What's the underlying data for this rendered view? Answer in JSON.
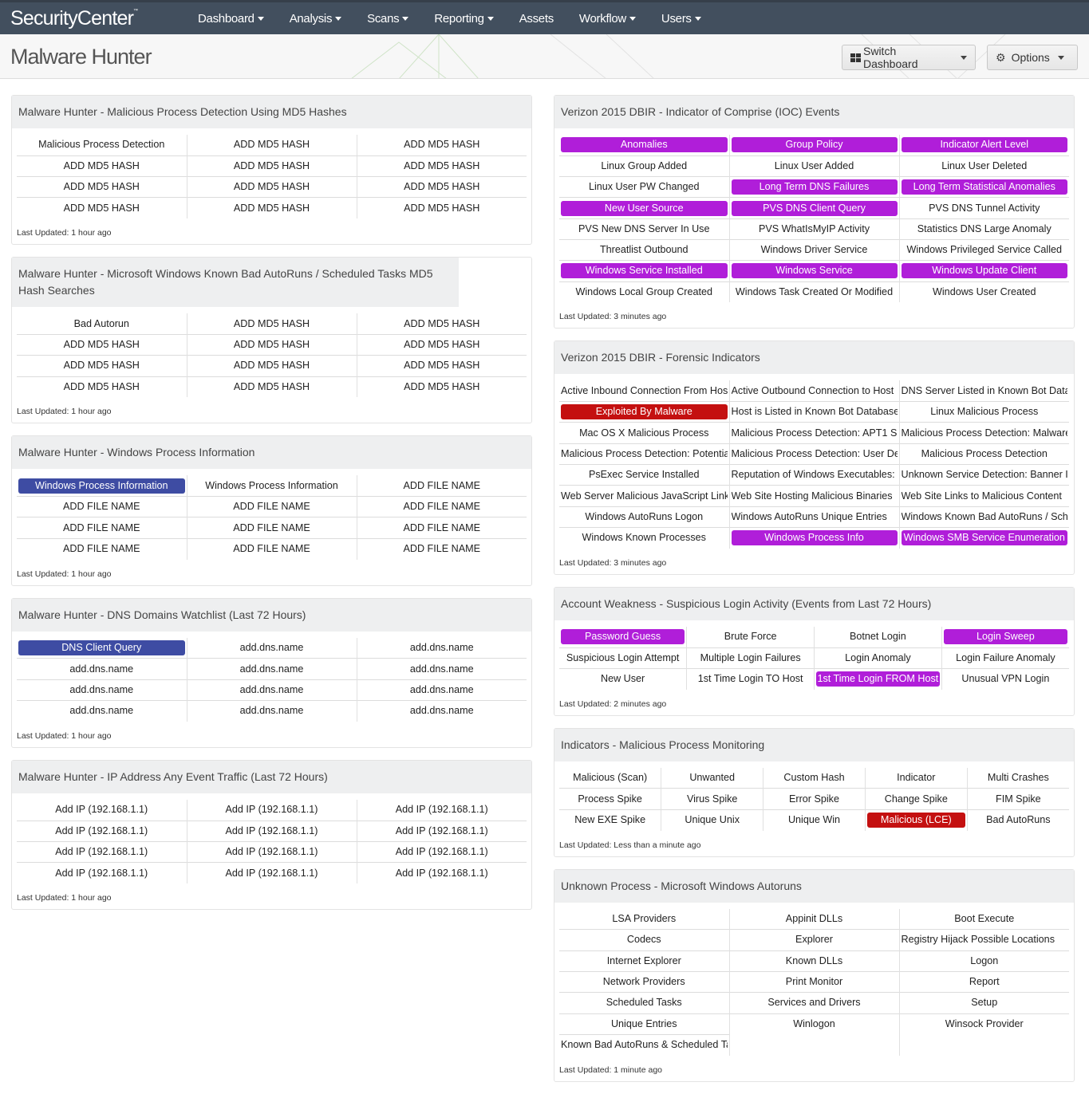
{
  "app": {
    "brand": "SecurityCenter",
    "nav": [
      "Dashboard",
      "Analysis",
      "Scans",
      "Reporting",
      "Assets",
      "Workflow",
      "Users"
    ],
    "nav_has_caret": [
      true,
      true,
      true,
      true,
      false,
      true,
      true
    ]
  },
  "header": {
    "title": "Malware Hunter",
    "switch_dashboard": "Switch Dashboard",
    "options": "Options"
  },
  "colors": {
    "nav_bg": "#424f5e",
    "purple": "#b01ed9",
    "red": "#c41010",
    "blue": "#3e4ca3"
  },
  "left_panels": [
    {
      "title": "Malware Hunter - Malicious Process Detection Using MD5 Hashes",
      "updated": "Last Updated: 1 hour ago",
      "cols": 3,
      "cells": [
        {
          "t": "Malicious Process Detection",
          "s": null
        },
        {
          "t": "ADD MD5 HASH",
          "s": null
        },
        {
          "t": "ADD MD5 HASH",
          "s": null
        },
        {
          "t": "ADD MD5 HASH",
          "s": null
        },
        {
          "t": "ADD MD5 HASH",
          "s": null
        },
        {
          "t": "ADD MD5 HASH",
          "s": null
        },
        {
          "t": "ADD MD5 HASH",
          "s": null
        },
        {
          "t": "ADD MD5 HASH",
          "s": null
        },
        {
          "t": "ADD MD5 HASH",
          "s": null
        },
        {
          "t": "ADD MD5 HASH",
          "s": null
        },
        {
          "t": "ADD MD5 HASH",
          "s": null
        },
        {
          "t": "ADD MD5 HASH",
          "s": null
        }
      ]
    },
    {
      "title": "Malware Hunter - Microsoft Windows Known Bad AutoRuns / Scheduled Tasks MD5 Hash Searches",
      "updated": "Last Updated: 1 hour ago",
      "cols": 3,
      "cells": [
        {
          "t": "Bad Autorun",
          "s": null
        },
        {
          "t": "ADD MD5 HASH",
          "s": null
        },
        {
          "t": "ADD MD5 HASH",
          "s": null
        },
        {
          "t": "ADD MD5 HASH",
          "s": null
        },
        {
          "t": "ADD MD5 HASH",
          "s": null
        },
        {
          "t": "ADD MD5 HASH",
          "s": null
        },
        {
          "t": "ADD MD5 HASH",
          "s": null
        },
        {
          "t": "ADD MD5 HASH",
          "s": null
        },
        {
          "t": "ADD MD5 HASH",
          "s": null
        },
        {
          "t": "ADD MD5 HASH",
          "s": null
        },
        {
          "t": "ADD MD5 HASH",
          "s": null
        },
        {
          "t": "ADD MD5 HASH",
          "s": null
        }
      ]
    },
    {
      "title": "Malware Hunter - Windows Process Information",
      "updated": "Last Updated: 1 hour ago",
      "cols": 3,
      "cells": [
        {
          "t": "Windows Process Information",
          "s": "blue"
        },
        {
          "t": "Windows Process Information",
          "s": null
        },
        {
          "t": "ADD FILE NAME",
          "s": null
        },
        {
          "t": "ADD FILE NAME",
          "s": null
        },
        {
          "t": "ADD FILE NAME",
          "s": null
        },
        {
          "t": "ADD FILE NAME",
          "s": null
        },
        {
          "t": "ADD FILE NAME",
          "s": null
        },
        {
          "t": "ADD FILE NAME",
          "s": null
        },
        {
          "t": "ADD FILE NAME",
          "s": null
        },
        {
          "t": "ADD FILE NAME",
          "s": null
        },
        {
          "t": "ADD FILE NAME",
          "s": null
        },
        {
          "t": "ADD FILE NAME",
          "s": null
        }
      ]
    },
    {
      "title": "Malware Hunter - DNS Domains Watchlist (Last 72 Hours)",
      "updated": "Last Updated: 1 hour ago",
      "cols": 3,
      "cells": [
        {
          "t": "DNS Client Query",
          "s": "blue"
        },
        {
          "t": "add.dns.name",
          "s": null
        },
        {
          "t": "add.dns.name",
          "s": null
        },
        {
          "t": "add.dns.name",
          "s": null
        },
        {
          "t": "add.dns.name",
          "s": null
        },
        {
          "t": "add.dns.name",
          "s": null
        },
        {
          "t": "add.dns.name",
          "s": null
        },
        {
          "t": "add.dns.name",
          "s": null
        },
        {
          "t": "add.dns.name",
          "s": null
        },
        {
          "t": "add.dns.name",
          "s": null
        },
        {
          "t": "add.dns.name",
          "s": null
        },
        {
          "t": "add.dns.name",
          "s": null
        }
      ]
    },
    {
      "title": "Malware Hunter - IP Address Any Event Traffic (Last 72 Hours)",
      "updated": "Last Updated: 1 hour ago",
      "cols": 3,
      "cells": [
        {
          "t": "Add IP (192.168.1.1)",
          "s": null
        },
        {
          "t": "Add IP (192.168.1.1)",
          "s": null
        },
        {
          "t": "Add IP (192.168.1.1)",
          "s": null
        },
        {
          "t": "Add IP (192.168.1.1)",
          "s": null
        },
        {
          "t": "Add IP (192.168.1.1)",
          "s": null
        },
        {
          "t": "Add IP (192.168.1.1)",
          "s": null
        },
        {
          "t": "Add IP (192.168.1.1)",
          "s": null
        },
        {
          "t": "Add IP (192.168.1.1)",
          "s": null
        },
        {
          "t": "Add IP (192.168.1.1)",
          "s": null
        },
        {
          "t": "Add IP (192.168.1.1)",
          "s": null
        },
        {
          "t": "Add IP (192.168.1.1)",
          "s": null
        },
        {
          "t": "Add IP (192.168.1.1)",
          "s": null
        }
      ]
    }
  ],
  "right_panels": [
    {
      "title": "Verizon 2015 DBIR - Indicator of Comprise (IOC) Events",
      "updated": "Last Updated: 3 minutes ago",
      "cols": 3,
      "cells": [
        {
          "t": "Anomalies",
          "s": "purple"
        },
        {
          "t": "Group Policy",
          "s": "purple"
        },
        {
          "t": "Indicator Alert Level",
          "s": "purple"
        },
        {
          "t": "Linux Group Added",
          "s": null
        },
        {
          "t": "Linux User Added",
          "s": null
        },
        {
          "t": "Linux User Deleted",
          "s": null
        },
        {
          "t": "Linux User PW Changed",
          "s": null
        },
        {
          "t": "Long Term DNS Failures",
          "s": "purple"
        },
        {
          "t": "Long Term Statistical Anomalies",
          "s": "purple"
        },
        {
          "t": "New User Source",
          "s": "purple"
        },
        {
          "t": "PVS DNS Client Query",
          "s": "purple"
        },
        {
          "t": "PVS DNS Tunnel Activity",
          "s": null
        },
        {
          "t": "PVS New DNS Server In Use",
          "s": null
        },
        {
          "t": "PVS WhatIsMyIP Activity",
          "s": null
        },
        {
          "t": "Statistics DNS Large Anomaly",
          "s": null
        },
        {
          "t": "Threatlist Outbound",
          "s": null
        },
        {
          "t": "Windows Driver Service",
          "s": null
        },
        {
          "t": "Windows Privileged Service Called",
          "s": null
        },
        {
          "t": "Windows Service Installed",
          "s": "purple"
        },
        {
          "t": "Windows Service",
          "s": "purple"
        },
        {
          "t": "Windows Update Client",
          "s": "purple"
        },
        {
          "t": "Windows Local Group Created",
          "s": null
        },
        {
          "t": "Windows Task Created Or Modified",
          "s": null
        },
        {
          "t": "Windows User Created",
          "s": null
        }
      ]
    },
    {
      "title": "Verizon 2015 DBIR - Forensic Indicators",
      "updated": "Last Updated: 3 minutes ago",
      "cols": 3,
      "clip": true,
      "cells": [
        {
          "t": "Active Inbound Connection From Host",
          "s": null
        },
        {
          "t": "Active Outbound Connection to Host",
          "s": null
        },
        {
          "t": "DNS Server Listed in Known Bot Database",
          "s": null
        },
        {
          "t": "Exploited By Malware",
          "s": "red"
        },
        {
          "t": "Host is Listed in Known Bot Database",
          "s": null
        },
        {
          "t": "Linux Malicious Process",
          "s": null
        },
        {
          "t": "Mac OS X Malicious Process",
          "s": null
        },
        {
          "t": "Malicious Process Detection: APT1 S",
          "s": null
        },
        {
          "t": "Malicious Process Detection: Malware",
          "s": null
        },
        {
          "t": "Malicious Process Detection: Potential",
          "s": null
        },
        {
          "t": "Malicious Process Detection: User De",
          "s": null
        },
        {
          "t": "Malicious Process Detection",
          "s": null
        },
        {
          "t": "PsExec Service Installed",
          "s": null
        },
        {
          "t": "Reputation of Windows Executables:",
          "s": null
        },
        {
          "t": "Unknown Service Detection: Banner I",
          "s": null
        },
        {
          "t": "Web Server Malicious JavaScript Link",
          "s": null
        },
        {
          "t": "Web Site Hosting Malicious Binaries",
          "s": null
        },
        {
          "t": "Web Site Links to Malicious Content",
          "s": null
        },
        {
          "t": "Windows AutoRuns Logon",
          "s": null
        },
        {
          "t": "Windows AutoRuns Unique Entries",
          "s": null
        },
        {
          "t": "Windows Known Bad AutoRuns / Sch",
          "s": null
        },
        {
          "t": "Windows Known Processes",
          "s": null
        },
        {
          "t": "Windows Process Info",
          "s": "purple"
        },
        {
          "t": "Windows SMB Service Enumeration",
          "s": "purple"
        }
      ]
    },
    {
      "title": "Account Weakness - Suspicious Login Activity (Events from Last 72 Hours)",
      "updated": "Last Updated: 2 minutes ago",
      "cols": 4,
      "cells": [
        {
          "t": "Password Guess",
          "s": "purple"
        },
        {
          "t": "Brute Force",
          "s": null
        },
        {
          "t": "Botnet Login",
          "s": null
        },
        {
          "t": "Login Sweep",
          "s": "purple"
        },
        {
          "t": "Suspicious Login Attempt",
          "s": null
        },
        {
          "t": "Multiple Login Failures",
          "s": null
        },
        {
          "t": "Login Anomaly",
          "s": null
        },
        {
          "t": "Login Failure Anomaly",
          "s": null
        },
        {
          "t": "New User",
          "s": null
        },
        {
          "t": "1st Time Login TO Host",
          "s": null
        },
        {
          "t": "1st Time Login FROM Host",
          "s": "purple"
        },
        {
          "t": "Unusual VPN Login",
          "s": null
        }
      ]
    },
    {
      "title": "Indicators - Malicious Process Monitoring",
      "updated": "Last Updated: Less than a minute ago",
      "cols": 5,
      "cells": [
        {
          "t": "Malicious (Scan)",
          "s": null
        },
        {
          "t": "Unwanted",
          "s": null
        },
        {
          "t": "Custom Hash",
          "s": null
        },
        {
          "t": "Indicator",
          "s": null
        },
        {
          "t": "Multi Crashes",
          "s": null
        },
        {
          "t": "Process Spike",
          "s": null
        },
        {
          "t": "Virus Spike",
          "s": null
        },
        {
          "t": "Error Spike",
          "s": null
        },
        {
          "t": "Change Spike",
          "s": null
        },
        {
          "t": "FIM Spike",
          "s": null
        },
        {
          "t": "New EXE Spike",
          "s": null
        },
        {
          "t": "Unique Unix",
          "s": null
        },
        {
          "t": "Unique Win",
          "s": null
        },
        {
          "t": "Malicious (LCE)",
          "s": "red"
        },
        {
          "t": "Bad AutoRuns",
          "s": null
        }
      ]
    },
    {
      "title": "Unknown Process - Microsoft Windows Autoruns",
      "updated": "Last Updated: 1 minute ago",
      "cols": 3,
      "clip": true,
      "cells": [
        {
          "t": "LSA Providers",
          "s": null
        },
        {
          "t": "Appinit DLLs",
          "s": null
        },
        {
          "t": "Boot Execute",
          "s": null
        },
        {
          "t": "Codecs",
          "s": null
        },
        {
          "t": "Explorer",
          "s": null
        },
        {
          "t": "Registry Hijack Possible Locations",
          "s": null
        },
        {
          "t": "Internet Explorer",
          "s": null
        },
        {
          "t": "Known DLLs",
          "s": null
        },
        {
          "t": "Logon",
          "s": null
        },
        {
          "t": "Network Providers",
          "s": null
        },
        {
          "t": "Print Monitor",
          "s": null
        },
        {
          "t": "Report",
          "s": null
        },
        {
          "t": "Scheduled Tasks",
          "s": null
        },
        {
          "t": "Services and Drivers",
          "s": null
        },
        {
          "t": "Setup",
          "s": null
        },
        {
          "t": "Unique Entries",
          "s": null
        },
        {
          "t": "Winlogon",
          "s": null
        },
        {
          "t": "Winsock Provider",
          "s": null
        },
        {
          "t": "Known Bad AutoRuns & Scheduled Tasks",
          "s": null
        }
      ]
    }
  ]
}
